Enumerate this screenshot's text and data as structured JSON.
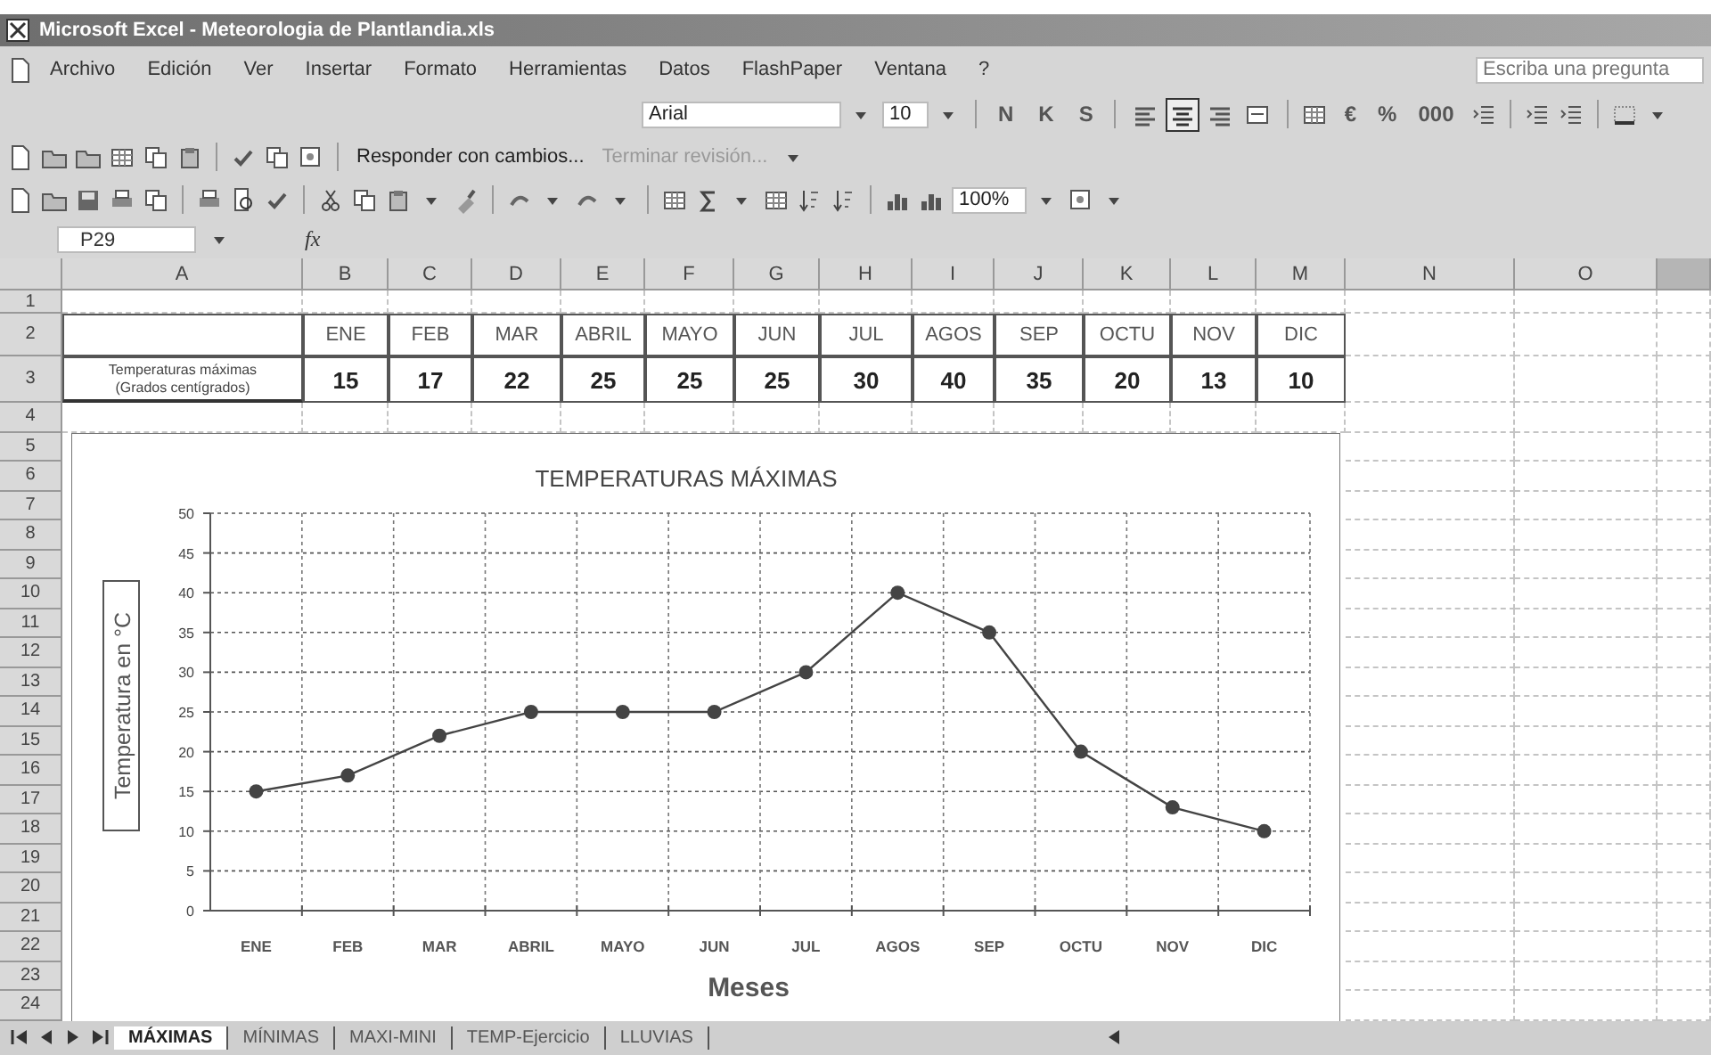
{
  "window": {
    "title": "Microsoft Excel - Meteorologia de Plantlandia.xls"
  },
  "menu": [
    "Archivo",
    "Edición",
    "Ver",
    "Insertar",
    "Formato",
    "Herramientas",
    "Datos",
    "FlashPaper",
    "Ventana",
    "?"
  ],
  "help_box": {
    "placeholder": "Escriba una pregunta"
  },
  "formatting_toolbar": {
    "font": "Arial",
    "size": "10",
    "style_buttons": [
      "N",
      "K",
      "S"
    ],
    "alignment": [
      {
        "selected": false
      },
      {
        "selected": true
      },
      {
        "selected": false
      },
      {
        "selected": false
      }
    ],
    "number_buttons": [
      "€",
      "%",
      "000"
    ]
  },
  "review_toolbar": {
    "items": [
      {
        "label": "Responder con cambios...",
        "disabled": false
      },
      {
        "label": "Terminar revisión...",
        "disabled": true
      }
    ]
  },
  "standard_toolbar": {
    "zoom": "100%"
  },
  "formula_bar": {
    "name_box": "P29",
    "function_label": "fx"
  },
  "sheet": {
    "columns": [
      "A",
      "B",
      "C",
      "D",
      "E",
      "F",
      "G",
      "H",
      "I",
      "J",
      "K",
      "L",
      "M",
      "N",
      "O"
    ],
    "rows": [
      "1",
      "2",
      "3",
      "4",
      "5",
      "6",
      "7",
      "8",
      "9",
      "10",
      "11",
      "12",
      "13",
      "14",
      "15",
      "16",
      "17",
      "18",
      "19",
      "20",
      "21",
      "22",
      "23",
      "24"
    ],
    "table": {
      "months": [
        "ENE",
        "FEB",
        "MAR",
        "ABRIL",
        "MAYO",
        "JUN",
        "JUL",
        "AGOS",
        "SEP",
        "OCTU",
        "NOV",
        "DIC"
      ],
      "row_label": [
        "Temperaturas máximas",
        "(Grados centígrados)"
      ],
      "values": [
        "15",
        "17",
        "22",
        "25",
        "25",
        "25",
        "30",
        "40",
        "35",
        "20",
        "13",
        "10"
      ]
    }
  },
  "chart": {
    "chart_data": {
      "type": "line",
      "title": "TEMPERATURAS MÁXIMAS",
      "xlabel": "Meses",
      "ylabel": "Temperatura en °C",
      "categories": [
        "ENE",
        "FEB",
        "MAR",
        "ABRIL",
        "MAYO",
        "JUN",
        "JUL",
        "AGOS",
        "SEP",
        "OCTU",
        "NOV",
        "DIC"
      ],
      "values": [
        15,
        17,
        22,
        25,
        25,
        25,
        30,
        40,
        35,
        20,
        13,
        10
      ],
      "grid": true,
      "marker": true,
      "ylim": [
        0,
        50
      ],
      "yticks": [
        0,
        5,
        10,
        15,
        20,
        25,
        30,
        35,
        40,
        45,
        50
      ]
    }
  },
  "sheet_tabs": [
    {
      "label": "MÁXIMAS",
      "selected": true
    },
    {
      "label": "MÍNIMAS",
      "selected": false
    },
    {
      "label": "MAXI-MINI",
      "selected": false
    },
    {
      "label": "TEMP-Ejercicio",
      "selected": false
    },
    {
      "label": "LLUVIAS",
      "selected": false
    }
  ]
}
